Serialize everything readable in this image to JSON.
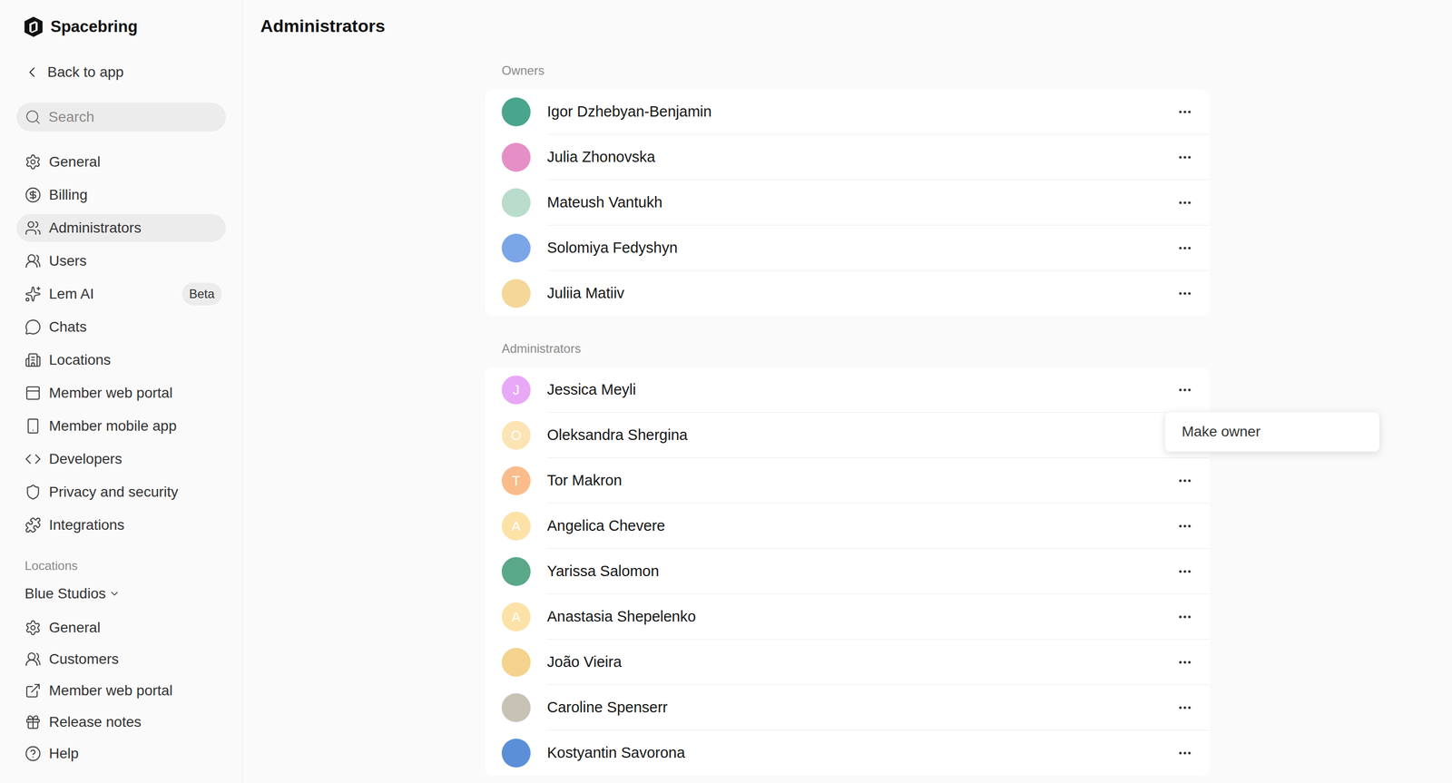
{
  "app": {
    "name": "Spacebring"
  },
  "sidebar": {
    "back": "Back to app",
    "search": {
      "placeholder": "Search"
    },
    "items": [
      {
        "label": "General",
        "selected": false
      },
      {
        "label": "Billing",
        "selected": false
      },
      {
        "label": "Administrators",
        "selected": true
      },
      {
        "label": "Users",
        "selected": false
      },
      {
        "label": "Lem AI",
        "selected": false,
        "badge": "Beta"
      },
      {
        "label": "Chats",
        "selected": false
      },
      {
        "label": "Locations",
        "selected": false
      },
      {
        "label": "Member web portal",
        "selected": false
      },
      {
        "label": "Member mobile app",
        "selected": false
      },
      {
        "label": "Developers",
        "selected": false
      },
      {
        "label": "Privacy and security",
        "selected": false
      },
      {
        "label": "Integrations",
        "selected": false
      }
    ],
    "locations_label": "Locations",
    "location": "Blue Studios",
    "location_items": [
      {
        "label": "General",
        "selected": false
      },
      {
        "label": "Customers",
        "selected": false
      },
      {
        "label": "Member web portal",
        "selected": false
      },
      {
        "label": "Release notes",
        "selected": false
      },
      {
        "label": "Help",
        "selected": false
      }
    ]
  },
  "page": {
    "title": "Administrators"
  },
  "sections": [
    {
      "label": "Owners",
      "members": [
        {
          "name": "Igor Dzhebyan-Benjamin",
          "menu_open": false,
          "avatar": {
            "kind": "photo",
            "color": "#4aa58f"
          }
        },
        {
          "name": "Julia Zhonovska",
          "menu_open": false,
          "avatar": {
            "kind": "photo",
            "color": "#e58fc6"
          }
        },
        {
          "name": "Mateush Vantukh",
          "menu_open": false,
          "avatar": {
            "kind": "photo",
            "color": "#b9dccb"
          }
        },
        {
          "name": "Solomiya Fedyshyn",
          "menu_open": false,
          "avatar": {
            "kind": "photo",
            "color": "#7aa6e8"
          }
        },
        {
          "name": "Juliia Matiiv",
          "menu_open": false,
          "avatar": {
            "kind": "photo",
            "color": "#f5d79a"
          }
        }
      ]
    },
    {
      "label": "Administrators",
      "members": [
        {
          "name": "Jessica Meyli",
          "menu_open": true,
          "avatar": {
            "kind": "initial",
            "initial": "J",
            "color": "#e9a8f7"
          }
        },
        {
          "name": "Oleksandra Shergina",
          "menu_open": false,
          "avatar": {
            "kind": "initial",
            "initial": "O",
            "color": "#fde4b4"
          }
        },
        {
          "name": "Tor Makron",
          "menu_open": false,
          "avatar": {
            "kind": "initial",
            "initial": "T",
            "color": "#fbbc8c"
          }
        },
        {
          "name": "Angelica Chevere",
          "menu_open": false,
          "avatar": {
            "kind": "initial",
            "initial": "A",
            "color": "#fde2a8"
          }
        },
        {
          "name": "Yarissa Salomon",
          "menu_open": false,
          "avatar": {
            "kind": "photo",
            "color": "#5aa88a"
          }
        },
        {
          "name": "Anastasia Shepelenko",
          "menu_open": false,
          "avatar": {
            "kind": "initial",
            "initial": "A",
            "color": "#fde2a8"
          }
        },
        {
          "name": "João Vieira",
          "menu_open": false,
          "avatar": {
            "kind": "photo",
            "color": "#f3d38e"
          }
        },
        {
          "name": "Caroline Spenserr",
          "menu_open": false,
          "avatar": {
            "kind": "photo",
            "color": "#c8c2b5"
          }
        },
        {
          "name": "Kostyantin Savorona",
          "menu_open": false,
          "avatar": {
            "kind": "photo",
            "color": "#5b8fd8"
          }
        }
      ]
    }
  ],
  "menu": {
    "items": [
      "Make owner"
    ]
  }
}
